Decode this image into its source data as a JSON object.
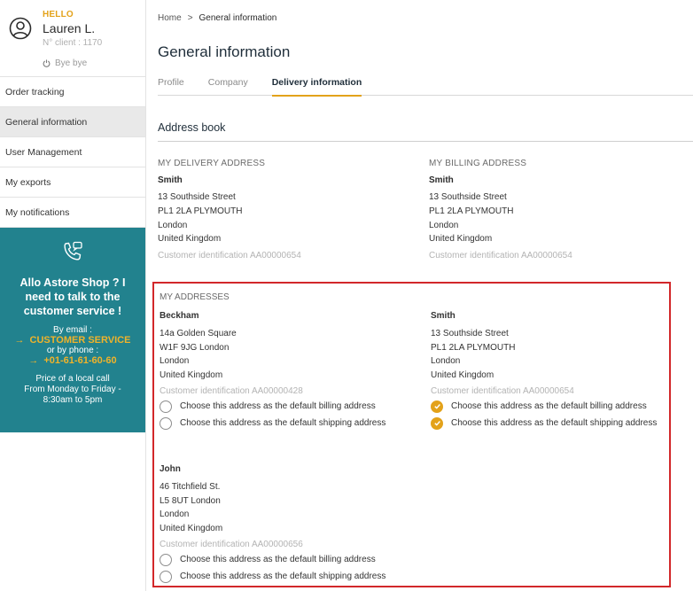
{
  "user": {
    "greeting": "HELLO",
    "name": "Lauren L.",
    "client_number": "N° client : 1170",
    "logout_label": "Bye bye"
  },
  "sidebar": {
    "items": [
      {
        "label": "Order tracking",
        "active": false
      },
      {
        "label": "General information",
        "active": true
      },
      {
        "label": "User Management",
        "active": false
      },
      {
        "label": "My exports",
        "active": false
      },
      {
        "label": "My notifications",
        "active": false
      }
    ]
  },
  "support": {
    "title": "Allo Astore Shop ? I need to talk to the customer service !",
    "by_email": "By email :",
    "email_link": "CUSTOMER SERVICE",
    "by_phone": "or by phone :",
    "phone_link": "+01-61-61-60-60",
    "note_line1": "Price of a local call",
    "note_line2": "From Monday to Friday -",
    "note_line3": "8:30am to 5pm",
    "accent_color": "#f0b32a",
    "bg_color": "#22828e"
  },
  "breadcrumb": {
    "home": "Home",
    "separator": ">",
    "current": "General information"
  },
  "page": {
    "title": "General information",
    "tabs": [
      {
        "label": "Profile",
        "active": false
      },
      {
        "label": "Company",
        "active": false
      },
      {
        "label": "Delivery information",
        "active": true
      }
    ],
    "section_title": "Address book"
  },
  "delivery_address": {
    "heading": "MY DELIVERY ADDRESS",
    "name": "Smith",
    "line1": "13 Southside Street",
    "line2": "PL1 2LA PLYMOUTH",
    "city": "London",
    "country": "United Kingdom",
    "ident": "Customer identification AA00000654"
  },
  "billing_address": {
    "heading": "MY BILLING ADDRESS",
    "name": "Smith",
    "line1": "13 Southside Street",
    "line2": "PL1 2LA PLYMOUTH",
    "city": "London",
    "country": "United Kingdom",
    "ident": "Customer identification AA00000654"
  },
  "my_addresses": {
    "heading": "MY ADDRESSES",
    "option_billing": "Choose this address as the default billing address",
    "option_shipping": "Choose this address as the default shipping address",
    "cards": [
      {
        "name": "Beckham",
        "line1": "14a Golden Square",
        "line2": "W1F 9JG London",
        "city": "London",
        "country": "United Kingdom",
        "ident": "Customer identification AA00000428",
        "default_billing": false,
        "default_shipping": false
      },
      {
        "name": "Smith",
        "line1": "13 Southside Street",
        "line2": "PL1 2LA PLYMOUTH",
        "city": "London",
        "country": "United Kingdom",
        "ident": "Customer identification AA00000654",
        "default_billing": true,
        "default_shipping": true
      },
      {
        "name": "John",
        "line1": "46 Titchfield St.",
        "line2": "L5 8UT London",
        "city": "London",
        "country": "United Kingdom",
        "ident": "Customer identification AA00000656",
        "default_billing": false,
        "default_shipping": false
      }
    ]
  },
  "colors": {
    "accent": "#e3a21a",
    "highlight_border": "#d2272a"
  }
}
